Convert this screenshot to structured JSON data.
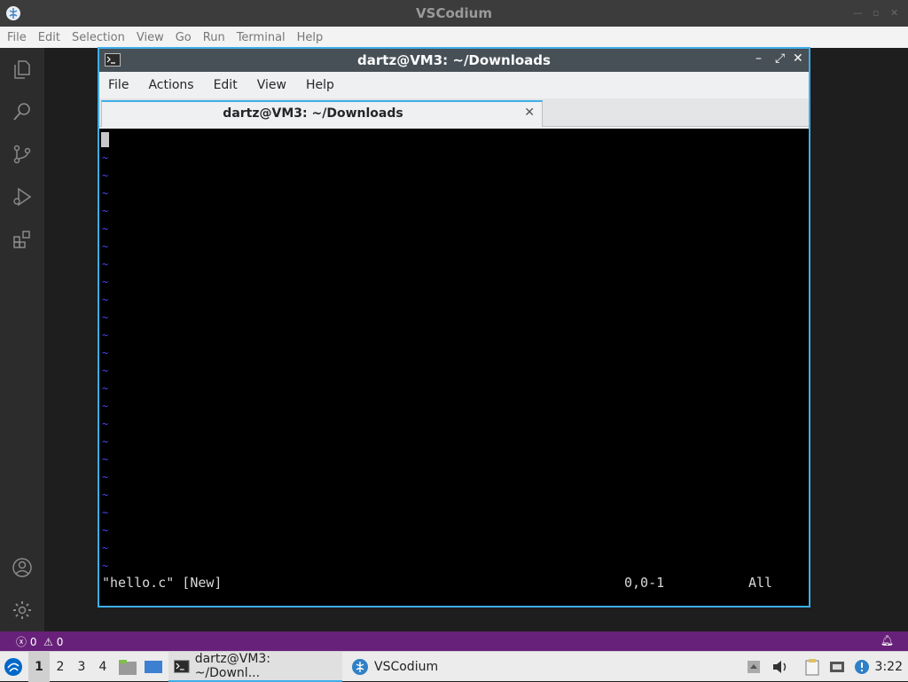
{
  "vscodium": {
    "title": "VSCodium",
    "menu": [
      "File",
      "Edit",
      "Selection",
      "View",
      "Go",
      "Run",
      "Terminal",
      "Help"
    ],
    "status": {
      "errors": "0",
      "warnings": "0"
    }
  },
  "terminal": {
    "window_title": "dartz@VM3: ~/Downloads",
    "menu": [
      "File",
      "Actions",
      "Edit",
      "View",
      "Help"
    ],
    "tab_label": "dartz@VM3: ~/Downloads",
    "tilde_char": "~",
    "vim_file_status": "\"hello.c\" [New]",
    "vim_cursor_pos": "0,0-1",
    "vim_scroll": "All"
  },
  "taskbar": {
    "workspaces": [
      "1",
      "2",
      "3",
      "4"
    ],
    "active_workspace": "1",
    "tasks": [
      {
        "label": "dartz@VM3: ~/Downl...",
        "icon": "terminal-icon",
        "active": true
      },
      {
        "label": "VSCodium",
        "icon": "vscodium-icon",
        "active": false
      }
    ],
    "clock": "3:22"
  },
  "colors": {
    "statusbar": "#68217a",
    "accent": "#3daee9",
    "vim_tilde": "#4848ff"
  }
}
